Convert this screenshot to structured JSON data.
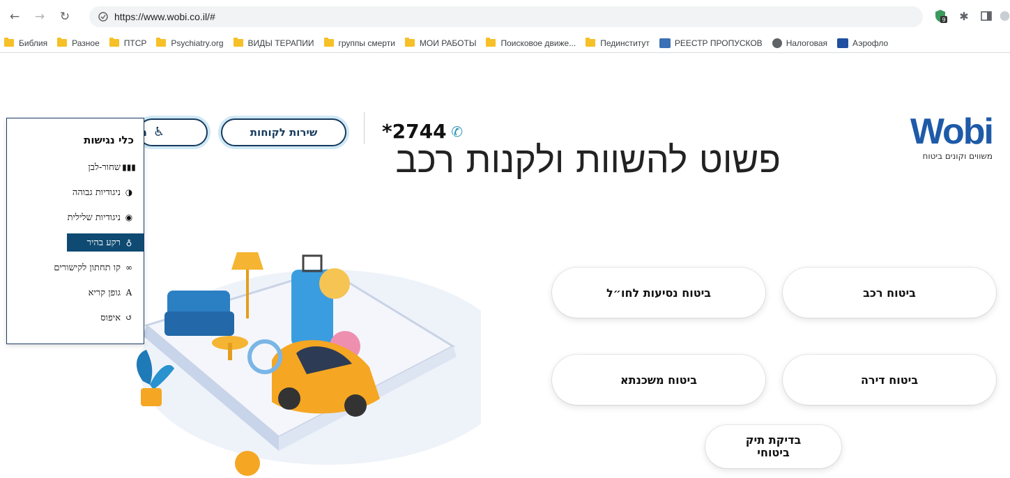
{
  "browser": {
    "url": "https://www.wobi.co.il/#",
    "extension_badge": "9",
    "bookmarks": [
      {
        "label": "Библия",
        "icon": "folder-icon"
      },
      {
        "label": "Разное",
        "icon": "folder-icon"
      },
      {
        "label": "ПТСР",
        "icon": "folder-icon"
      },
      {
        "label": "Psychiatry.org",
        "icon": "folder-icon"
      },
      {
        "label": "ВИДЫ ТЕРАПИИ",
        "icon": "folder-icon"
      },
      {
        "label": "группы смерти",
        "icon": "folder-icon"
      },
      {
        "label": "МОИ РАБОТЫ",
        "icon": "folder-icon"
      },
      {
        "label": "Поисковое движе...",
        "icon": "folder-icon"
      },
      {
        "label": "Пединститут",
        "icon": "folder-icon"
      },
      {
        "label": "РЕЕСТР ПРОПУСКОВ",
        "icon": "emblem-icon"
      },
      {
        "label": "Налоговая",
        "icon": "globe-icon"
      },
      {
        "label": "Аэрофло",
        "icon": "airline-icon"
      }
    ]
  },
  "header": {
    "logo_text": "Wobi",
    "logo_tagline": "משווים וקונים ביטוח",
    "phone": "*2744",
    "customer_service": "שירות לקוחות",
    "accessibility_button_text": "מ"
  },
  "hero": {
    "title": "פשוט להשוות ולקנות רכב"
  },
  "accessibility_panel": {
    "title": "כלי נגישות",
    "items": [
      {
        "label": "שחור-לבן",
        "icon": "barcode-icon",
        "glyph": "▮▮▮"
      },
      {
        "label": "ניגודיות גבוהה",
        "icon": "contrast-icon",
        "glyph": "◑"
      },
      {
        "label": "ניגודיות שלילית",
        "icon": "eye-icon",
        "glyph": "◉"
      },
      {
        "label": "רקע בהיר",
        "icon": "lightbulb-icon",
        "glyph": "♁"
      },
      {
        "label": "קו תחתון לקישורים",
        "icon": "link-icon",
        "glyph": "∞"
      },
      {
        "label": "גופן קריא",
        "icon": "font-icon",
        "glyph": "A"
      },
      {
        "label": "איפוס",
        "icon": "reset-icon",
        "glyph": "↺"
      }
    ],
    "active_index": 3
  },
  "insurance": {
    "car": "ביטוח רכב",
    "travel": "ביטוח נסיעות לחו״ל",
    "apartment": "ביטוח דירה",
    "mortgage": "ביטוח משכנתא",
    "portfolio_line1": "בדיקת תיק",
    "portfolio_line2": "ביטוחי"
  },
  "colors": {
    "brand_blue": "#1e5aa8",
    "brand_light": "#52b6e8",
    "navy": "#163a5c",
    "active_item": "#0e4a72"
  }
}
